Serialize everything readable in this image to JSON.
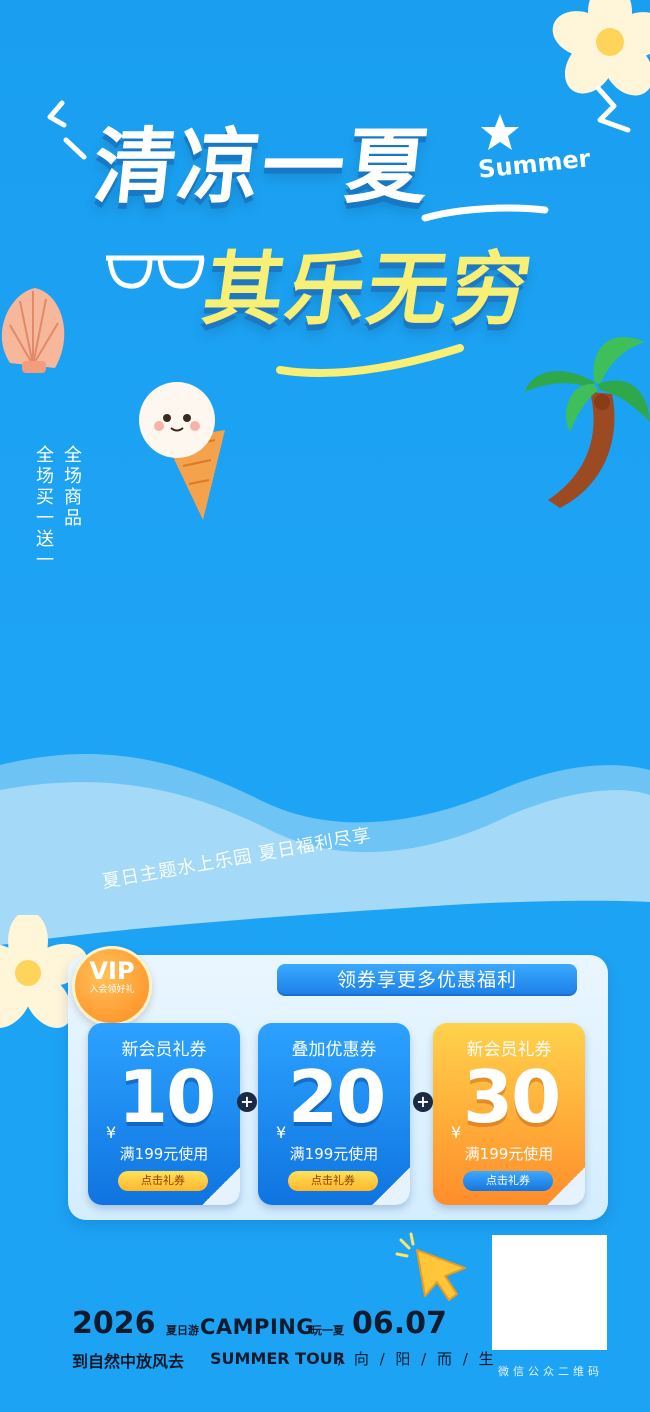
{
  "headline": {
    "line1": "清凉一夏",
    "line2": "其乐无穷",
    "summer_word": "Summer"
  },
  "side_text": {
    "col1": "全场商品",
    "col2": "全场买一送一"
  },
  "tagline": "夏日主题水上乐园 夏日福利尽享",
  "panel": {
    "vip_label": "VIP",
    "vip_sub": "入会领好礼",
    "tab_label": "领券享更多优惠福利"
  },
  "coupons": [
    {
      "title": "新会员礼券",
      "yen": "¥",
      "amount": "10",
      "condition": "满199元使用",
      "button": "点击礼券",
      "style": "blue"
    },
    {
      "title": "叠加优惠券",
      "yen": "¥",
      "amount": "20",
      "condition": "满199元使用",
      "button": "点击礼券",
      "style": "blue"
    },
    {
      "title": "新会员礼券",
      "yen": "¥",
      "amount": "30",
      "condition": "满199元使用",
      "button": "点击礼券",
      "style": "orange"
    }
  ],
  "plus_sign": "+",
  "footer": {
    "year": "2026",
    "small1": "夏日游",
    "camping": "CAMPING",
    "small2": "玩一夏",
    "date": "06.07",
    "line2a": "到自然中放风去",
    "line2b": "SUMMER TOUR",
    "line2c": "/ 向 / 阳 / 而 / 生",
    "qr_label": "微信公众二维码"
  },
  "colors": {
    "background": "#1ea4f5",
    "headline_yellow": "#f7ef76",
    "coupon_blue": "#1a8af0",
    "coupon_orange": "#ff9e30",
    "dark_text": "#0f1b2d"
  },
  "icons": [
    "sparkle-icon",
    "sunglasses-icon",
    "star-icon",
    "shell-icon",
    "ice-cream-icon",
    "palm-tree-icon",
    "flower-icon",
    "cursor-icon"
  ]
}
